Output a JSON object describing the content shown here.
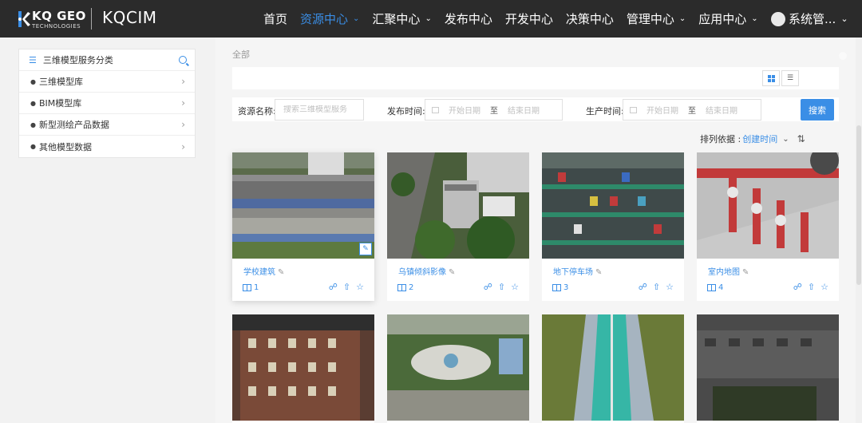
{
  "header": {
    "logo_brand": "KQ GEO",
    "logo_sub": "TECHNOLOGIES",
    "product": "KQCIM",
    "nav": [
      {
        "label": "首页",
        "active": false,
        "dropdown": false
      },
      {
        "label": "资源中心",
        "active": true,
        "dropdown": true
      },
      {
        "label": "汇聚中心",
        "active": false,
        "dropdown": true
      },
      {
        "label": "发布中心",
        "active": false,
        "dropdown": false
      },
      {
        "label": "开发中心",
        "active": false,
        "dropdown": false
      },
      {
        "label": "决策中心",
        "active": false,
        "dropdown": false
      },
      {
        "label": "管理中心",
        "active": false,
        "dropdown": true
      },
      {
        "label": "应用中心",
        "active": false,
        "dropdown": true
      }
    ],
    "user": "系统管..."
  },
  "sidebar": {
    "title": "三维模型服务分类",
    "items": [
      {
        "label": "三维模型库"
      },
      {
        "label": "BIM模型库"
      },
      {
        "label": "新型测绘产品数据"
      },
      {
        "label": "其他模型数据"
      }
    ]
  },
  "breadcrumb": "全部",
  "filter": {
    "name_label": "资源名称:",
    "name_placeholder": "搜索三维模型服务",
    "publish_label": "发布时间:",
    "produce_label": "生产时间:",
    "start_placeholder": "开始日期",
    "end_placeholder": "结束日期",
    "to": "至",
    "search_button": "搜索"
  },
  "sort": {
    "label": "排列依据 :",
    "value": "创建时间"
  },
  "cards": [
    {
      "title": "学校建筑",
      "count": "1"
    },
    {
      "title": "乌镇倾斜影像",
      "count": "2"
    },
    {
      "title": "地下停车场",
      "count": "3"
    },
    {
      "title": "室内地图",
      "count": "4"
    }
  ],
  "colors": {
    "accent": "#3a8ee6",
    "topbar": "#2b2b2b"
  },
  "icons": [
    "logo-icon",
    "chevron-down-icon",
    "avatar-icon",
    "list-icon",
    "search-icon",
    "globe-icon",
    "chevron-right-icon",
    "grid-view-icon",
    "list-view-icon",
    "calendar-icon",
    "sort-order-icon",
    "edit-icon",
    "book-icon",
    "unlock-icon",
    "upload-icon",
    "star-icon"
  ]
}
